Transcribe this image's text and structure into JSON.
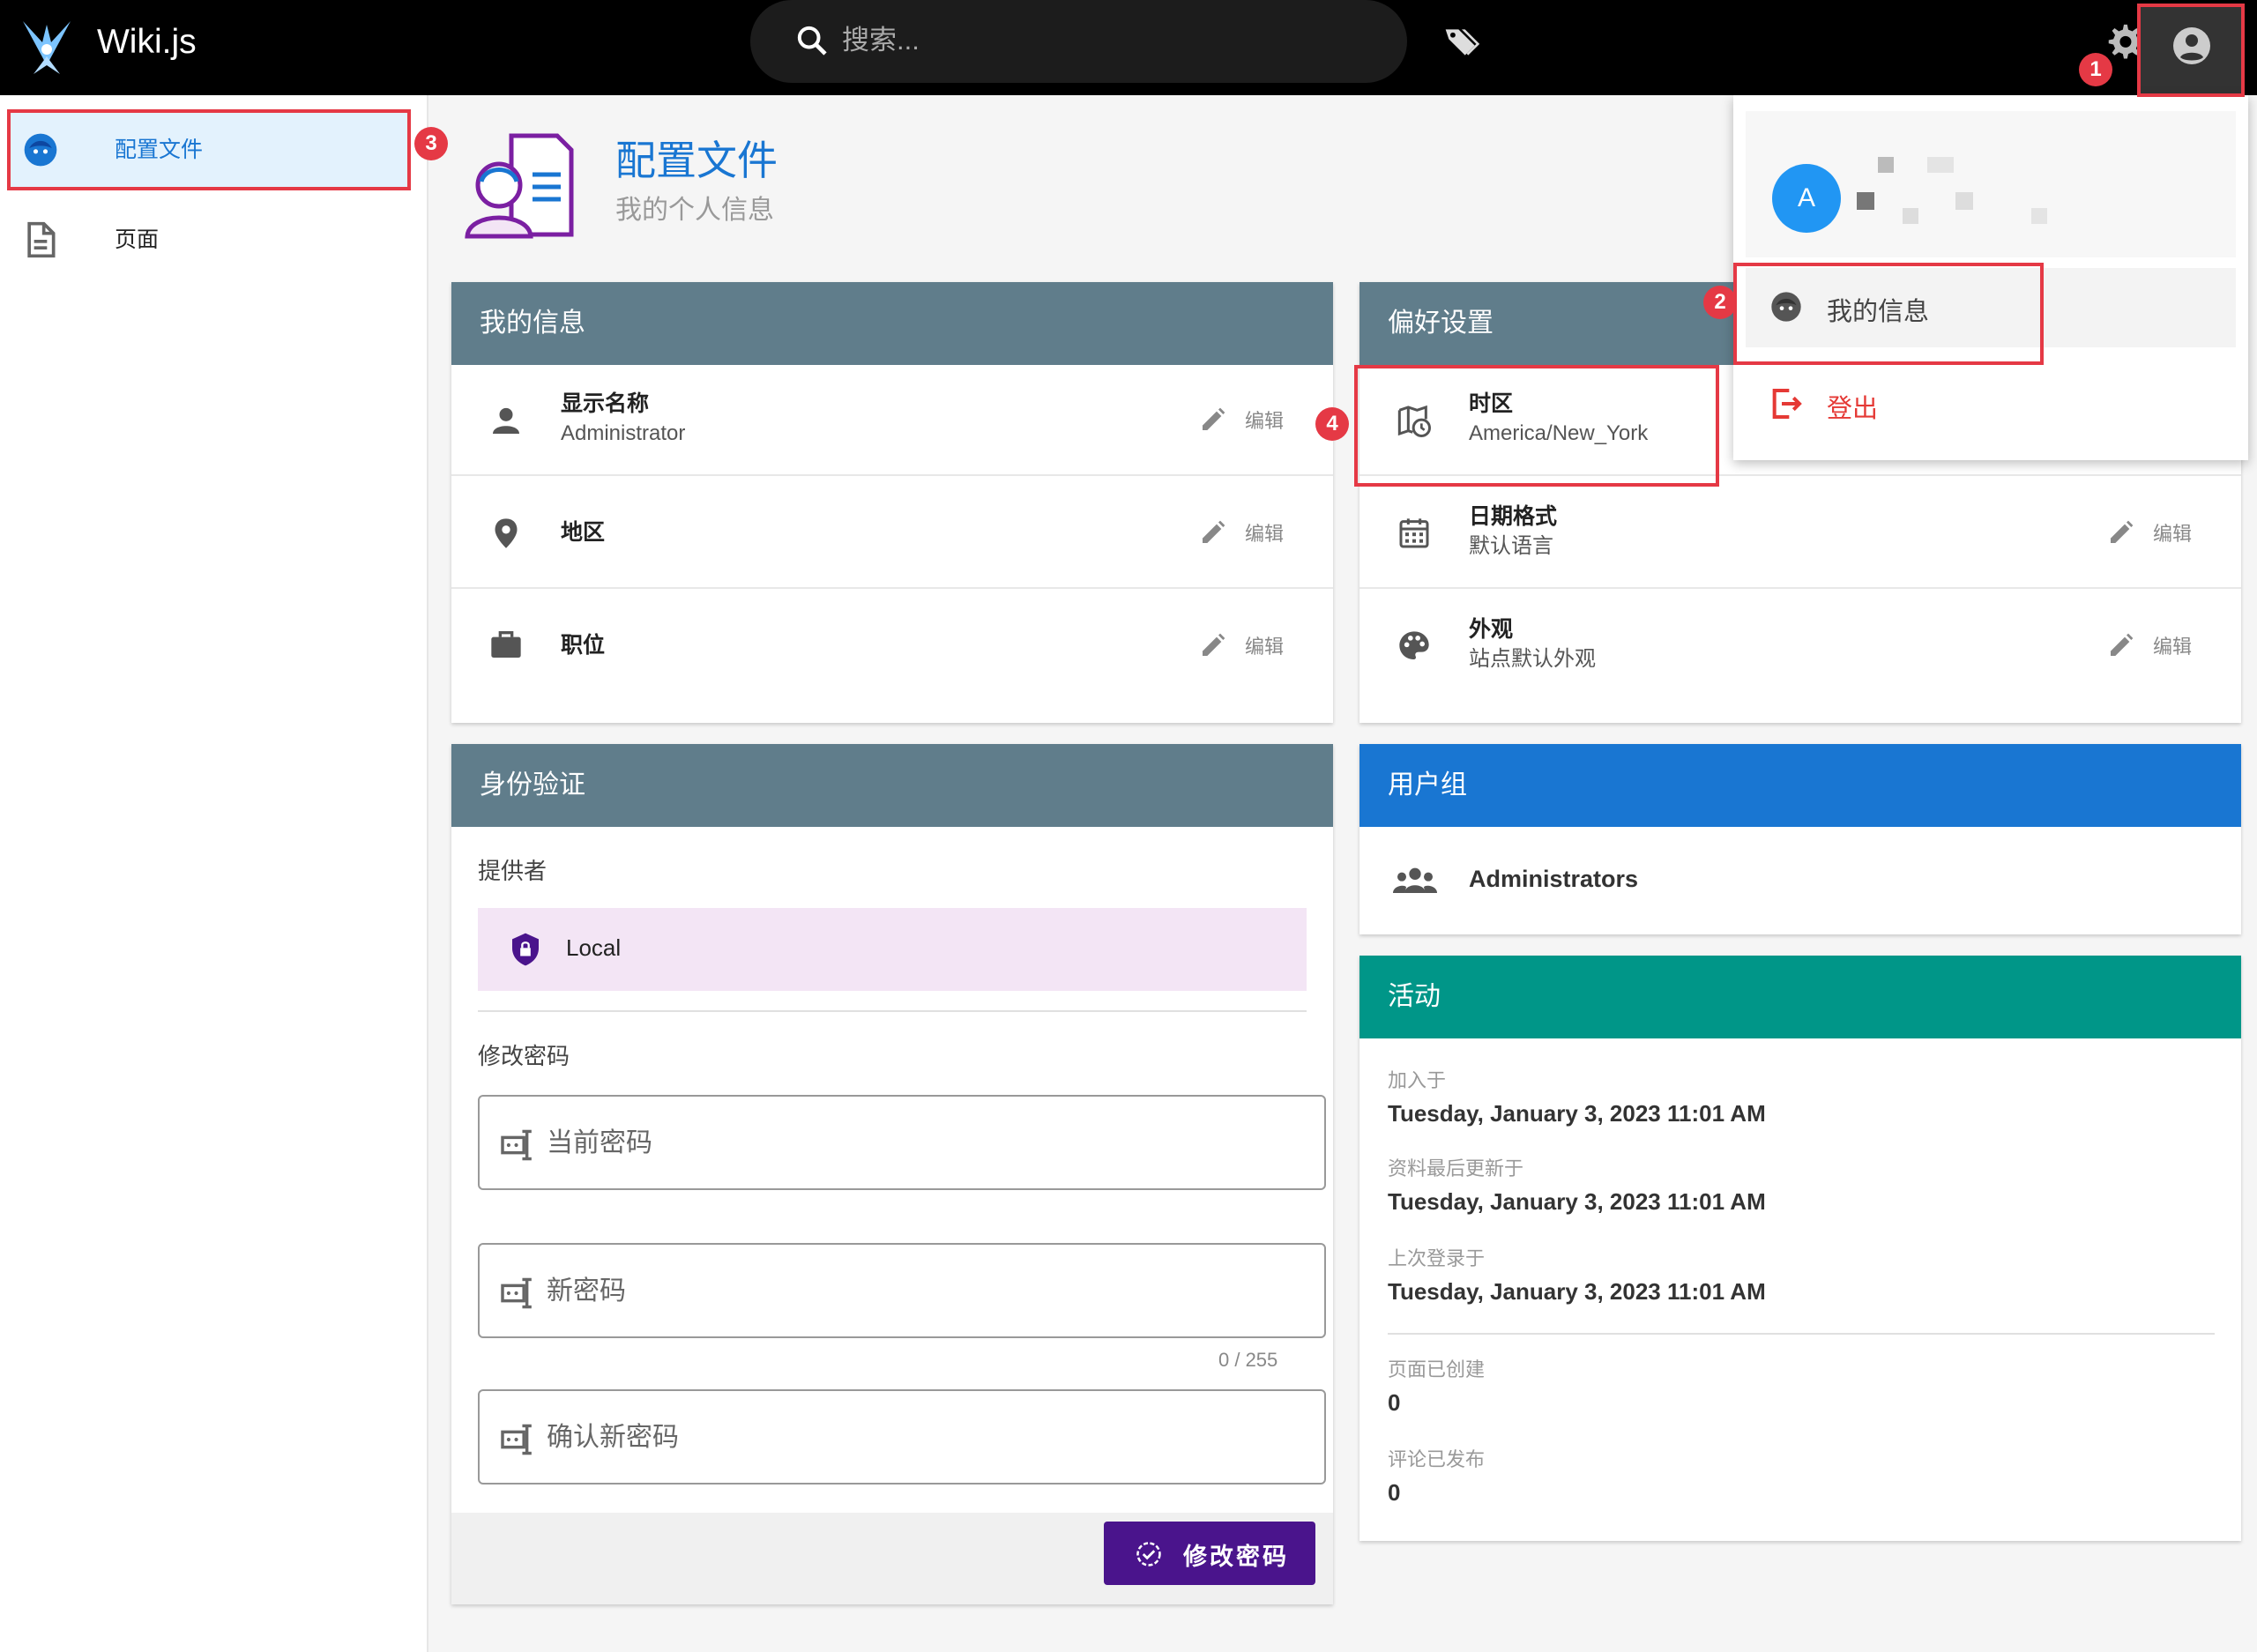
{
  "app": {
    "name": "Wiki.js"
  },
  "search": {
    "placeholder": "搜索..."
  },
  "sidebar": {
    "items": [
      {
        "label": "配置文件"
      },
      {
        "label": "页面"
      }
    ]
  },
  "page": {
    "title": "配置文件",
    "subtitle": "我的个人信息"
  },
  "my_info": {
    "header": "我的信息",
    "rows": [
      {
        "title": "显示名称",
        "value": "Administrator",
        "edit": "编辑"
      },
      {
        "title": "地区",
        "edit": "编辑"
      },
      {
        "title": "职位",
        "edit": "编辑"
      }
    ]
  },
  "auth": {
    "header": "身份验证",
    "provider_label": "提供者",
    "provider": "Local",
    "change_pw_label": "修改密码",
    "current_pw": "当前密码",
    "new_pw": "新密码",
    "counter": "0 / 255",
    "confirm_pw": "确认新密码",
    "button": "修改密码"
  },
  "prefs": {
    "header": "偏好设置",
    "rows": [
      {
        "title": "时区",
        "value": "America/New_York"
      },
      {
        "title": "日期格式",
        "value": "默认语言",
        "edit": "编辑"
      },
      {
        "title": "外观",
        "value": "站点默认外观",
        "edit": "编辑"
      }
    ]
  },
  "groups": {
    "header": "用户组",
    "item": "Administrators"
  },
  "activity": {
    "header": "活动",
    "joined_label": "加入于",
    "joined": "Tuesday, January 3, 2023 11:01 AM",
    "updated_label": "资料最后更新于",
    "updated": "Tuesday, January 3, 2023 11:01 AM",
    "login_label": "上次登录于",
    "login": "Tuesday, January 3, 2023 11:01 AM",
    "pages_label": "页面已创建",
    "pages": "0",
    "comments_label": "评论已发布",
    "comments": "0"
  },
  "account_menu": {
    "avatar_letter": "A",
    "my_info": "我的信息",
    "logout": "登出"
  },
  "annotations": [
    "1",
    "2",
    "3",
    "4"
  ],
  "colors": {
    "topbar": "#000000",
    "primary": "#1976d2",
    "card_header_grey": "#607d8b",
    "groups_header": "#1976d2",
    "activity_header": "#009688",
    "provider_bg": "#f3e5f5",
    "button": "#4a148c",
    "logout": "#e53935",
    "annotation_red": "#e53945"
  },
  "icons": [
    "wiki-logo-icon",
    "search-icon",
    "tags-icon",
    "gear-icon",
    "account-circle-icon",
    "profile-face-icon",
    "page-icon",
    "person-icon",
    "location-pin-icon",
    "briefcase-icon",
    "shield-lock-icon",
    "password-icon",
    "timezone-map-icon",
    "calendar-icon",
    "palette-icon",
    "edit-pencil-icon",
    "people-group-icon",
    "logout-icon",
    "check-circle-icon"
  ]
}
